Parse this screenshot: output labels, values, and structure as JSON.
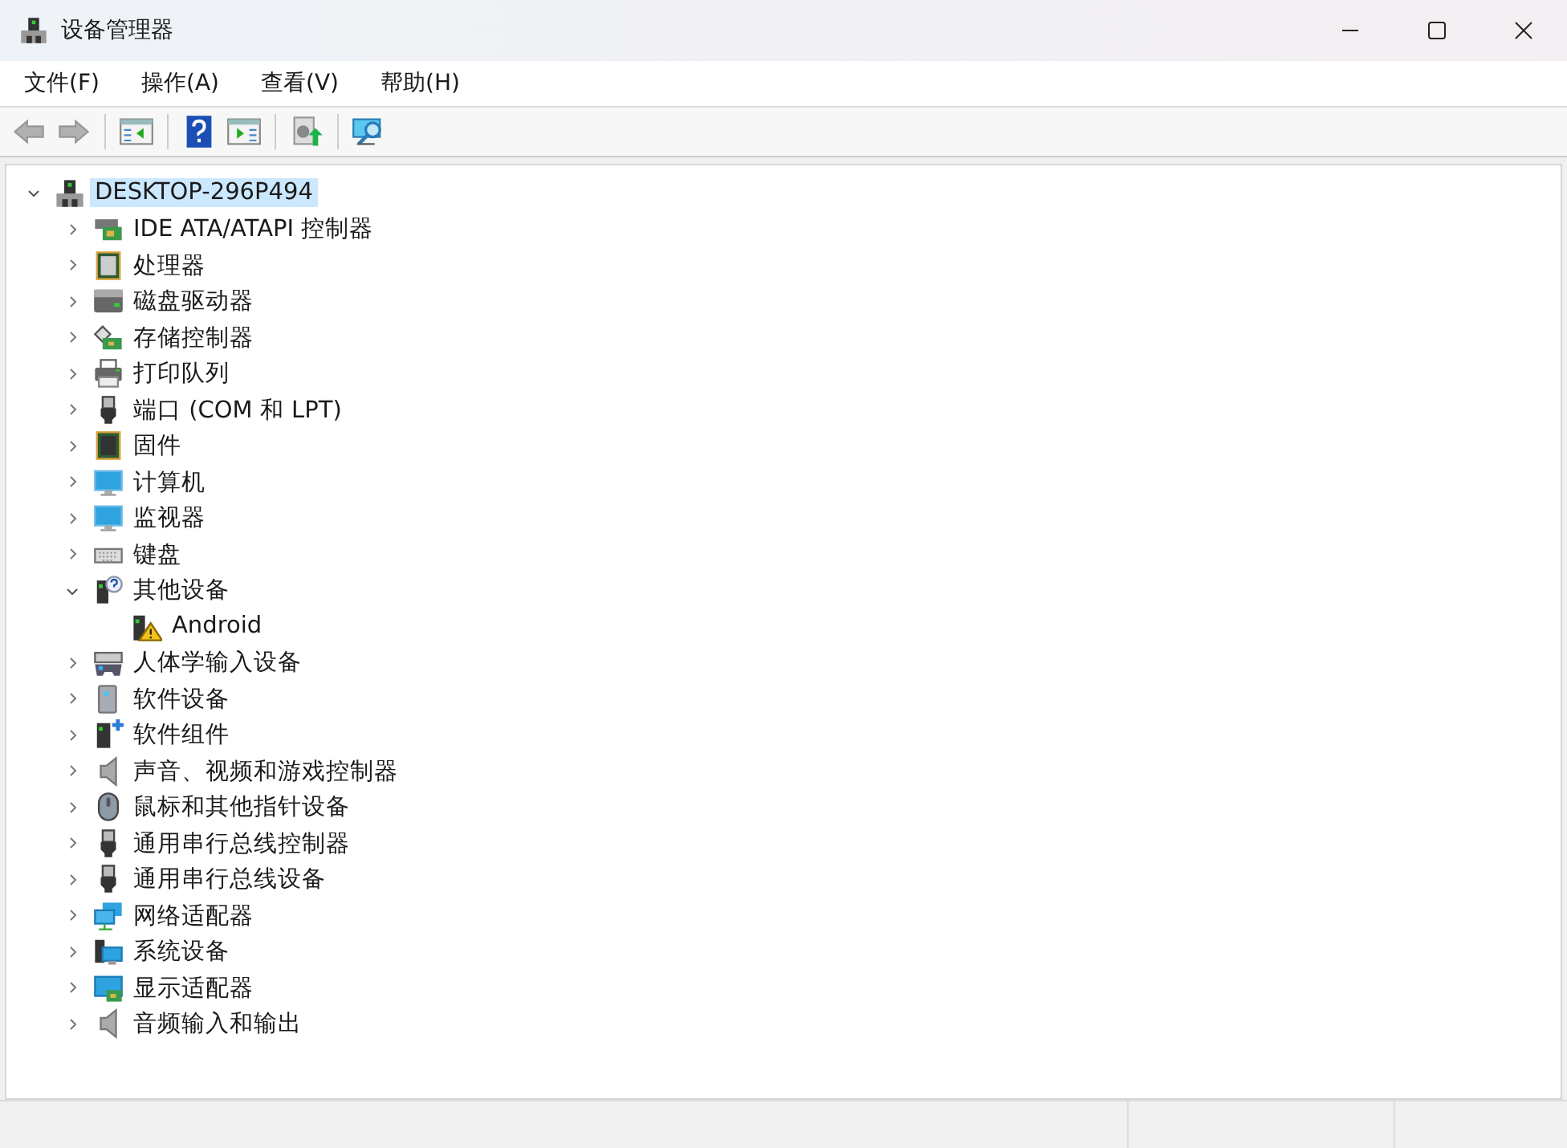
{
  "window": {
    "title": "设备管理器"
  },
  "menu": [
    {
      "label": "文件(F)"
    },
    {
      "label": "操作(A)"
    },
    {
      "label": "查看(V)"
    },
    {
      "label": "帮助(H)"
    }
  ],
  "toolbar": [
    {
      "kind": "back",
      "disabled": true
    },
    {
      "kind": "forward",
      "disabled": true
    },
    {
      "kind": "separator"
    },
    {
      "kind": "console-tree",
      "disabled": false
    },
    {
      "kind": "separator"
    },
    {
      "kind": "help",
      "disabled": false
    },
    {
      "kind": "action-pane",
      "disabled": false
    },
    {
      "kind": "separator"
    },
    {
      "kind": "update-driver",
      "disabled": false
    },
    {
      "kind": "separator"
    },
    {
      "kind": "scan",
      "disabled": false
    }
  ],
  "tree": {
    "label": "DESKTOP-296P494",
    "kind": "host",
    "expanded": true,
    "selected": true,
    "children": [
      {
        "label": "IDE ATA/ATAPI 控制器",
        "kind": "controller",
        "expanded": false,
        "selected": false
      },
      {
        "label": "处理器",
        "kind": "cpu",
        "expanded": false,
        "selected": false
      },
      {
        "label": "磁盘驱动器",
        "kind": "disk",
        "expanded": false,
        "selected": false
      },
      {
        "label": "存储控制器",
        "kind": "storage",
        "expanded": false,
        "selected": false
      },
      {
        "label": "打印队列",
        "kind": "printer",
        "expanded": false,
        "selected": false
      },
      {
        "label": "端口 (COM 和 LPT)",
        "kind": "port",
        "expanded": false,
        "selected": false
      },
      {
        "label": "固件",
        "kind": "firmware",
        "expanded": false,
        "selected": false
      },
      {
        "label": "计算机",
        "kind": "computer",
        "expanded": false,
        "selected": false
      },
      {
        "label": "监视器",
        "kind": "monitor",
        "expanded": false,
        "selected": false
      },
      {
        "label": "键盘",
        "kind": "keyboard",
        "expanded": false,
        "selected": false
      },
      {
        "label": "其他设备",
        "kind": "unknown",
        "expanded": true,
        "selected": false,
        "children": [
          {
            "label": "Android",
            "kind": "warning",
            "selected": false
          }
        ]
      },
      {
        "label": "人体学输入设备",
        "kind": "hid",
        "expanded": false,
        "selected": false
      },
      {
        "label": "软件设备",
        "kind": "software-device",
        "expanded": false,
        "selected": false
      },
      {
        "label": "软件组件",
        "kind": "software-component",
        "expanded": false,
        "selected": false
      },
      {
        "label": "声音、视频和游戏控制器",
        "kind": "speaker",
        "expanded": false,
        "selected": false
      },
      {
        "label": "鼠标和其他指针设备",
        "kind": "mouse",
        "expanded": false,
        "selected": false
      },
      {
        "label": "通用串行总线控制器",
        "kind": "usb",
        "expanded": false,
        "selected": false
      },
      {
        "label": "通用串行总线设备",
        "kind": "usb",
        "expanded": false,
        "selected": false
      },
      {
        "label": "网络适配器",
        "kind": "network",
        "expanded": false,
        "selected": false
      },
      {
        "label": "系统设备",
        "kind": "system",
        "expanded": false,
        "selected": false
      },
      {
        "label": "显示适配器",
        "kind": "display",
        "expanded": false,
        "selected": false
      },
      {
        "label": "音频输入和输出",
        "kind": "speaker",
        "expanded": false,
        "selected": false
      }
    ]
  }
}
